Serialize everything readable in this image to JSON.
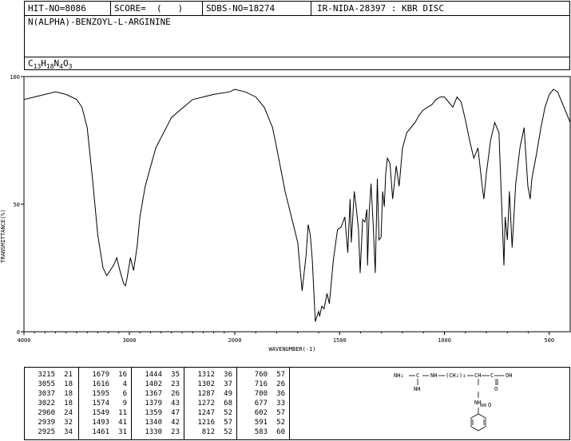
{
  "header": {
    "hit_no": "HIT-NO=8086",
    "score": "SCORE=  (   )",
    "sdbs_no": "SDBS-NO=18274",
    "method": "IR-NIDA-28397 : KBR DISC",
    "compound": "N(ALPHA)-BENZOYL-L-ARGININE",
    "formula": {
      "c": "C",
      "c_n": "13",
      "h": "H",
      "h_n": "18",
      "n": "N",
      "n_n": "4",
      "o": "O",
      "o_n": "3"
    }
  },
  "chart_data": {
    "type": "line",
    "title": "",
    "xlabel": "WAVENUMBER(-1)",
    "ylabel": "TRANSMITTANCE(%)",
    "xlim": [
      4000,
      400
    ],
    "ylim": [
      0,
      100
    ],
    "x_ticks": [
      4000,
      3000,
      2000,
      1500,
      1000,
      500
    ],
    "y_ticks": [
      0,
      50,
      100
    ],
    "grid": false,
    "series": [
      {
        "name": "",
        "x": [
          4000,
          3900,
          3800,
          3700,
          3600,
          3500,
          3450,
          3400,
          3350,
          3300,
          3250,
          3215,
          3150,
          3120,
          3090,
          3055,
          3037,
          3022,
          2990,
          2960,
          2939,
          2925,
          2900,
          2850,
          2750,
          2600,
          2400,
          2200,
          2050,
          2000,
          1950,
          1900,
          1860,
          1820,
          1800,
          1760,
          1730,
          1700,
          1679,
          1660,
          1650,
          1640,
          1630,
          1616,
          1600,
          1595,
          1585,
          1574,
          1560,
          1549,
          1530,
          1510,
          1493,
          1475,
          1461,
          1450,
          1444,
          1430,
          1420,
          1410,
          1402,
          1390,
          1379,
          1370,
          1367,
          1359,
          1350,
          1340,
          1330,
          1320,
          1312,
          1302,
          1295,
          1287,
          1280,
          1272,
          1260,
          1247,
          1230,
          1216,
          1200,
          1180,
          1160,
          1140,
          1120,
          1100,
          1080,
          1060,
          1040,
          1020,
          1000,
          980,
          960,
          940,
          920,
          900,
          880,
          860,
          840,
          820,
          812,
          800,
          780,
          760,
          740,
          716,
          710,
          700,
          690,
          677,
          660,
          640,
          620,
          602,
          591,
          583,
          560,
          540,
          520,
          500,
          480,
          460,
          440,
          420,
          400
        ],
        "y": [
          91,
          92,
          93,
          94,
          93,
          91,
          88,
          80,
          60,
          38,
          25,
          22,
          26,
          29,
          24,
          19,
          18,
          21,
          29,
          24,
          30,
          34,
          45,
          57,
          72,
          84,
          91,
          93,
          94,
          95,
          94,
          92,
          88,
          80,
          72,
          55,
          45,
          35,
          16,
          30,
          42,
          38,
          28,
          4,
          8,
          6,
          10,
          9,
          15,
          11,
          28,
          40,
          41,
          45,
          31,
          52,
          35,
          55,
          48,
          40,
          23,
          44,
          43,
          48,
          26,
          47,
          58,
          42,
          23,
          60,
          36,
          37,
          55,
          49,
          62,
          68,
          66,
          52,
          65,
          57,
          72,
          78,
          80,
          82,
          85,
          87,
          88,
          89,
          91,
          92,
          92,
          90,
          88,
          92,
          90,
          83,
          75,
          68,
          72,
          57,
          52,
          62,
          75,
          82,
          78,
          26,
          45,
          36,
          55,
          33,
          58,
          72,
          80,
          57,
          52,
          60,
          70,
          80,
          88,
          93,
          95,
          94,
          90,
          86,
          82
        ]
      }
    ]
  },
  "peaks": [
    [
      [
        "3215",
        "21"
      ],
      [
        "3055",
        "18"
      ],
      [
        "3037",
        "18"
      ],
      [
        "3022",
        "18"
      ],
      [
        "2960",
        "24"
      ],
      [
        "2939",
        "32"
      ],
      [
        "2925",
        "34"
      ]
    ],
    [
      [
        "1679",
        "16"
      ],
      [
        "1616",
        "4"
      ],
      [
        "1595",
        "6"
      ],
      [
        "1574",
        "9"
      ],
      [
        "1549",
        "11"
      ],
      [
        "1493",
        "41"
      ],
      [
        "1461",
        "31"
      ]
    ],
    [
      [
        "1444",
        "35"
      ],
      [
        "1402",
        "23"
      ],
      [
        "1367",
        "26"
      ],
      [
        "1379",
        "43"
      ],
      [
        "1359",
        "47"
      ],
      [
        "1340",
        "42"
      ],
      [
        "1330",
        "23"
      ]
    ],
    [
      [
        "1312",
        "36"
      ],
      [
        "1302",
        "37"
      ],
      [
        "1287",
        "49"
      ],
      [
        "1272",
        "68"
      ],
      [
        "1247",
        "52"
      ],
      [
        "1216",
        "57"
      ],
      [
        "812",
        "52"
      ]
    ],
    [
      [
        "760",
        "57"
      ],
      [
        "716",
        "26"
      ],
      [
        "700",
        "36"
      ],
      [
        "677",
        "33"
      ],
      [
        "602",
        "57"
      ],
      [
        "591",
        "52"
      ],
      [
        "583",
        "60"
      ]
    ]
  ],
  "structure": {
    "nh2": "NH₂",
    "c1": "C",
    "nh_top": "NH",
    "ch2": "(CH₂)₃",
    "ch": "CH",
    "c2": "C",
    "oh": "OH",
    "nh_bottom": "NH",
    "o1": "O",
    "nh_imine": "NH",
    "c3": "C",
    "o2": "O"
  }
}
